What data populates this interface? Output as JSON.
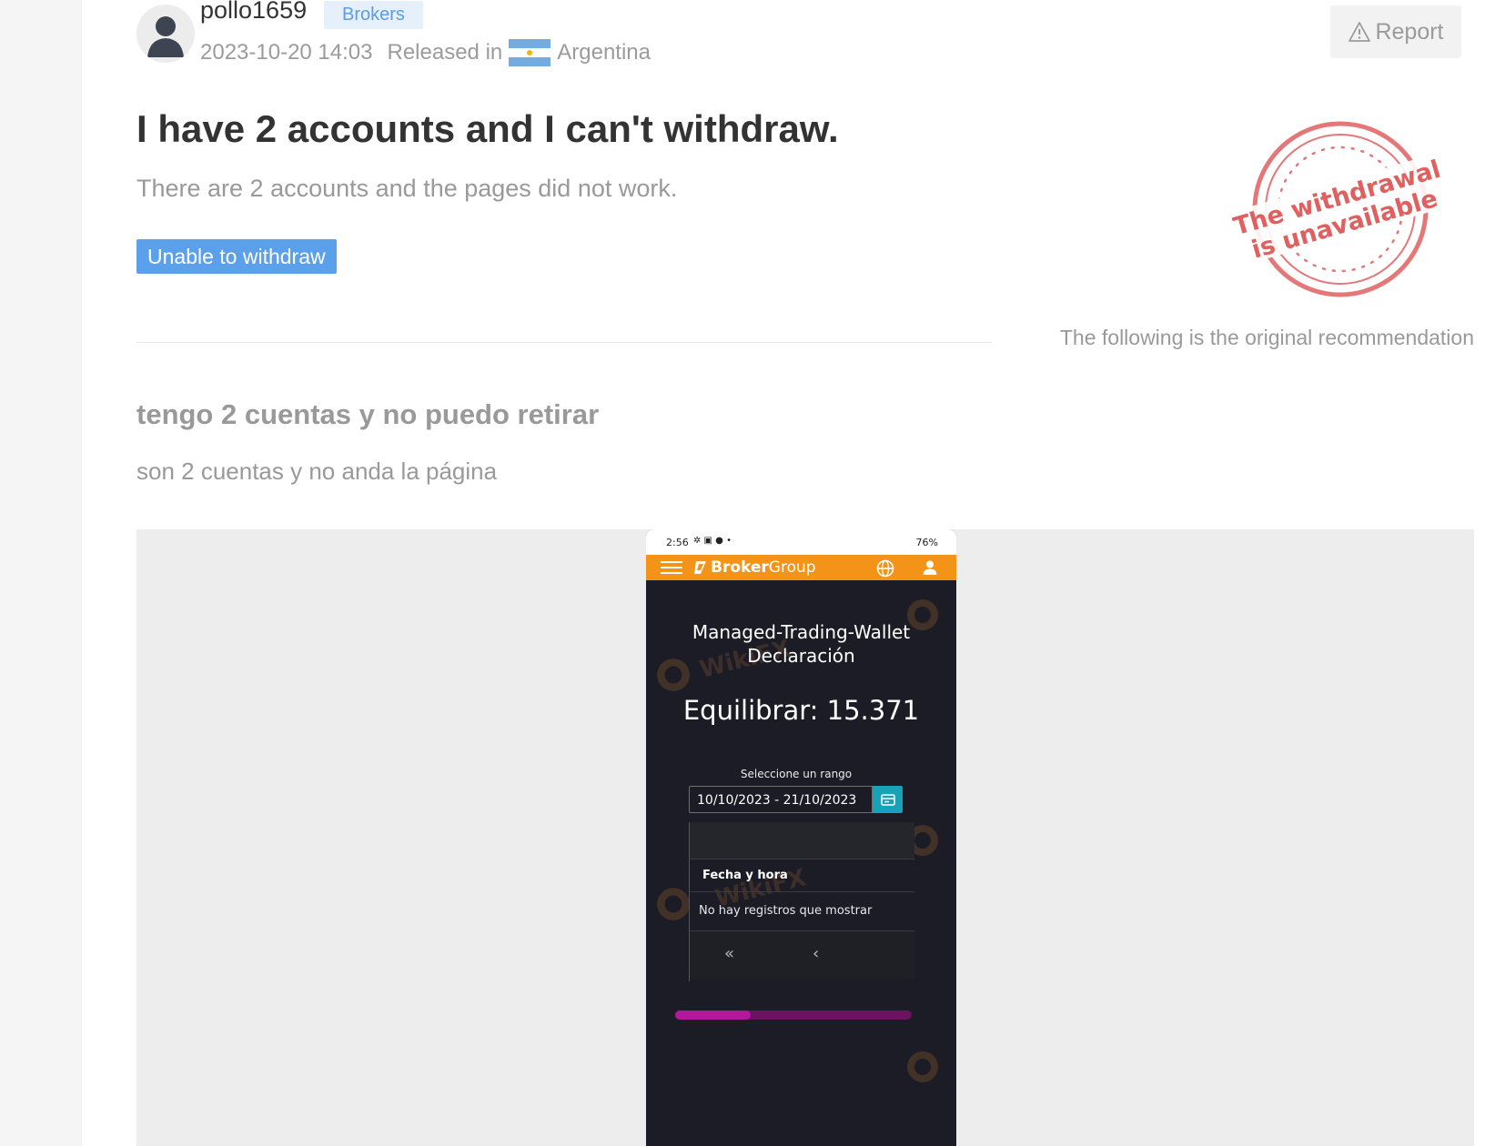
{
  "post": {
    "username": "pollo1659",
    "badge": "Brokers",
    "datetime": "2023-10-20 14:03",
    "released_in": "Released in",
    "country": "Argentina",
    "report": "Report",
    "title": "I have 2 accounts and I can't withdraw.",
    "description": "There are 2 accounts and the pages did not work.",
    "tag": "Unable to withdraw",
    "stamp_line1": "The withdrawal",
    "stamp_line2": "is unavailable",
    "original_label": "The following is the original recommendation",
    "original_title": "tengo 2 cuentas y no puedo retirar",
    "original_description": "son 2 cuentas y no anda la página"
  },
  "screenshot": {
    "time": "2:56",
    "battery": "76%",
    "brand_bold": "Broker",
    "brand_light": "Group",
    "wallet_title": "Managed-Trading-Wallet Declaración",
    "balance": "Equilibrar: 15.371",
    "range_label": "Seleccione un rango",
    "date_range": "10/10/2023 - 21/10/2023",
    "column_header": "Fecha y hora",
    "empty_message": "No hay registros que mostrar",
    "pager_first": "«",
    "pager_prev": "‹",
    "watermark": "WikiFX",
    "progress": 0.32
  },
  "colors": {
    "accent": "#5ba0ea",
    "brand_orange": "#f39418",
    "stamp_red": "#e06060"
  }
}
